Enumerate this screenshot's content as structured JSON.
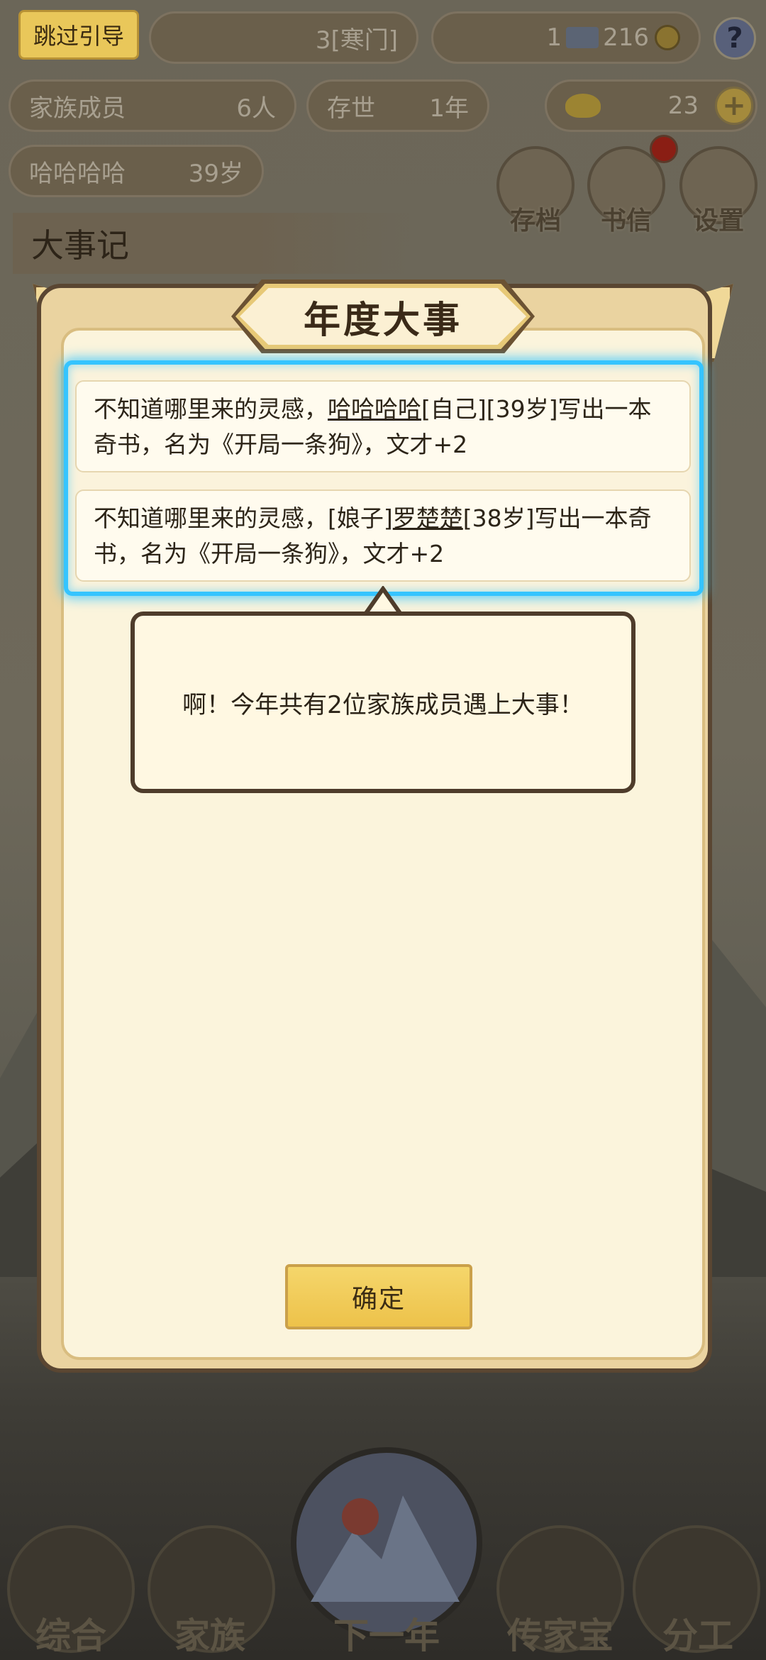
{
  "hud": {
    "skip_label": "跳过引导",
    "rank_text": "3[寒门]",
    "silver_value": "1",
    "coin_value": "216",
    "help_symbol": "?",
    "members_label": "家族成员",
    "members_count": "6人",
    "survive_label": "存世",
    "survive_value": "1年",
    "gold_value": "23",
    "plus_symbol": "+",
    "leader_name": "哈哈哈哈",
    "leader_age": "39岁"
  },
  "top_icons": [
    {
      "label": "存档",
      "icon": "archive-icon"
    },
    {
      "label": "书信",
      "icon": "letter-icon"
    },
    {
      "label": "设置",
      "icon": "settings-icon"
    }
  ],
  "section_title": "大事记",
  "bottom_nav": [
    {
      "label": "综合",
      "icon": "scroll-icon"
    },
    {
      "label": "家族",
      "icon": "temple-icon"
    },
    {
      "label": "下一年",
      "icon": "mountain-icon"
    },
    {
      "label": "传家宝",
      "icon": "jade-icon"
    },
    {
      "label": "分工",
      "icon": "people-icon"
    }
  ],
  "modal": {
    "title": "年度大事",
    "events": [
      {
        "prefix": "不知道哪里来的灵感，",
        "tag1": "",
        "name": "哈哈哈哈",
        "tag2": "[自己][39岁]写出一本奇书，名为《开局一条狗》，文才+2"
      },
      {
        "prefix": "不知道哪里来的灵感，",
        "tag1": "[娘子]",
        "name": "罗楚楚",
        "tag2": "[38岁]写出一本奇书，名为《开局一条狗》，文才+2"
      }
    ],
    "bubble_text": "啊！今年共有2位家族成员遇上大事！",
    "confirm_label": "确定"
  }
}
